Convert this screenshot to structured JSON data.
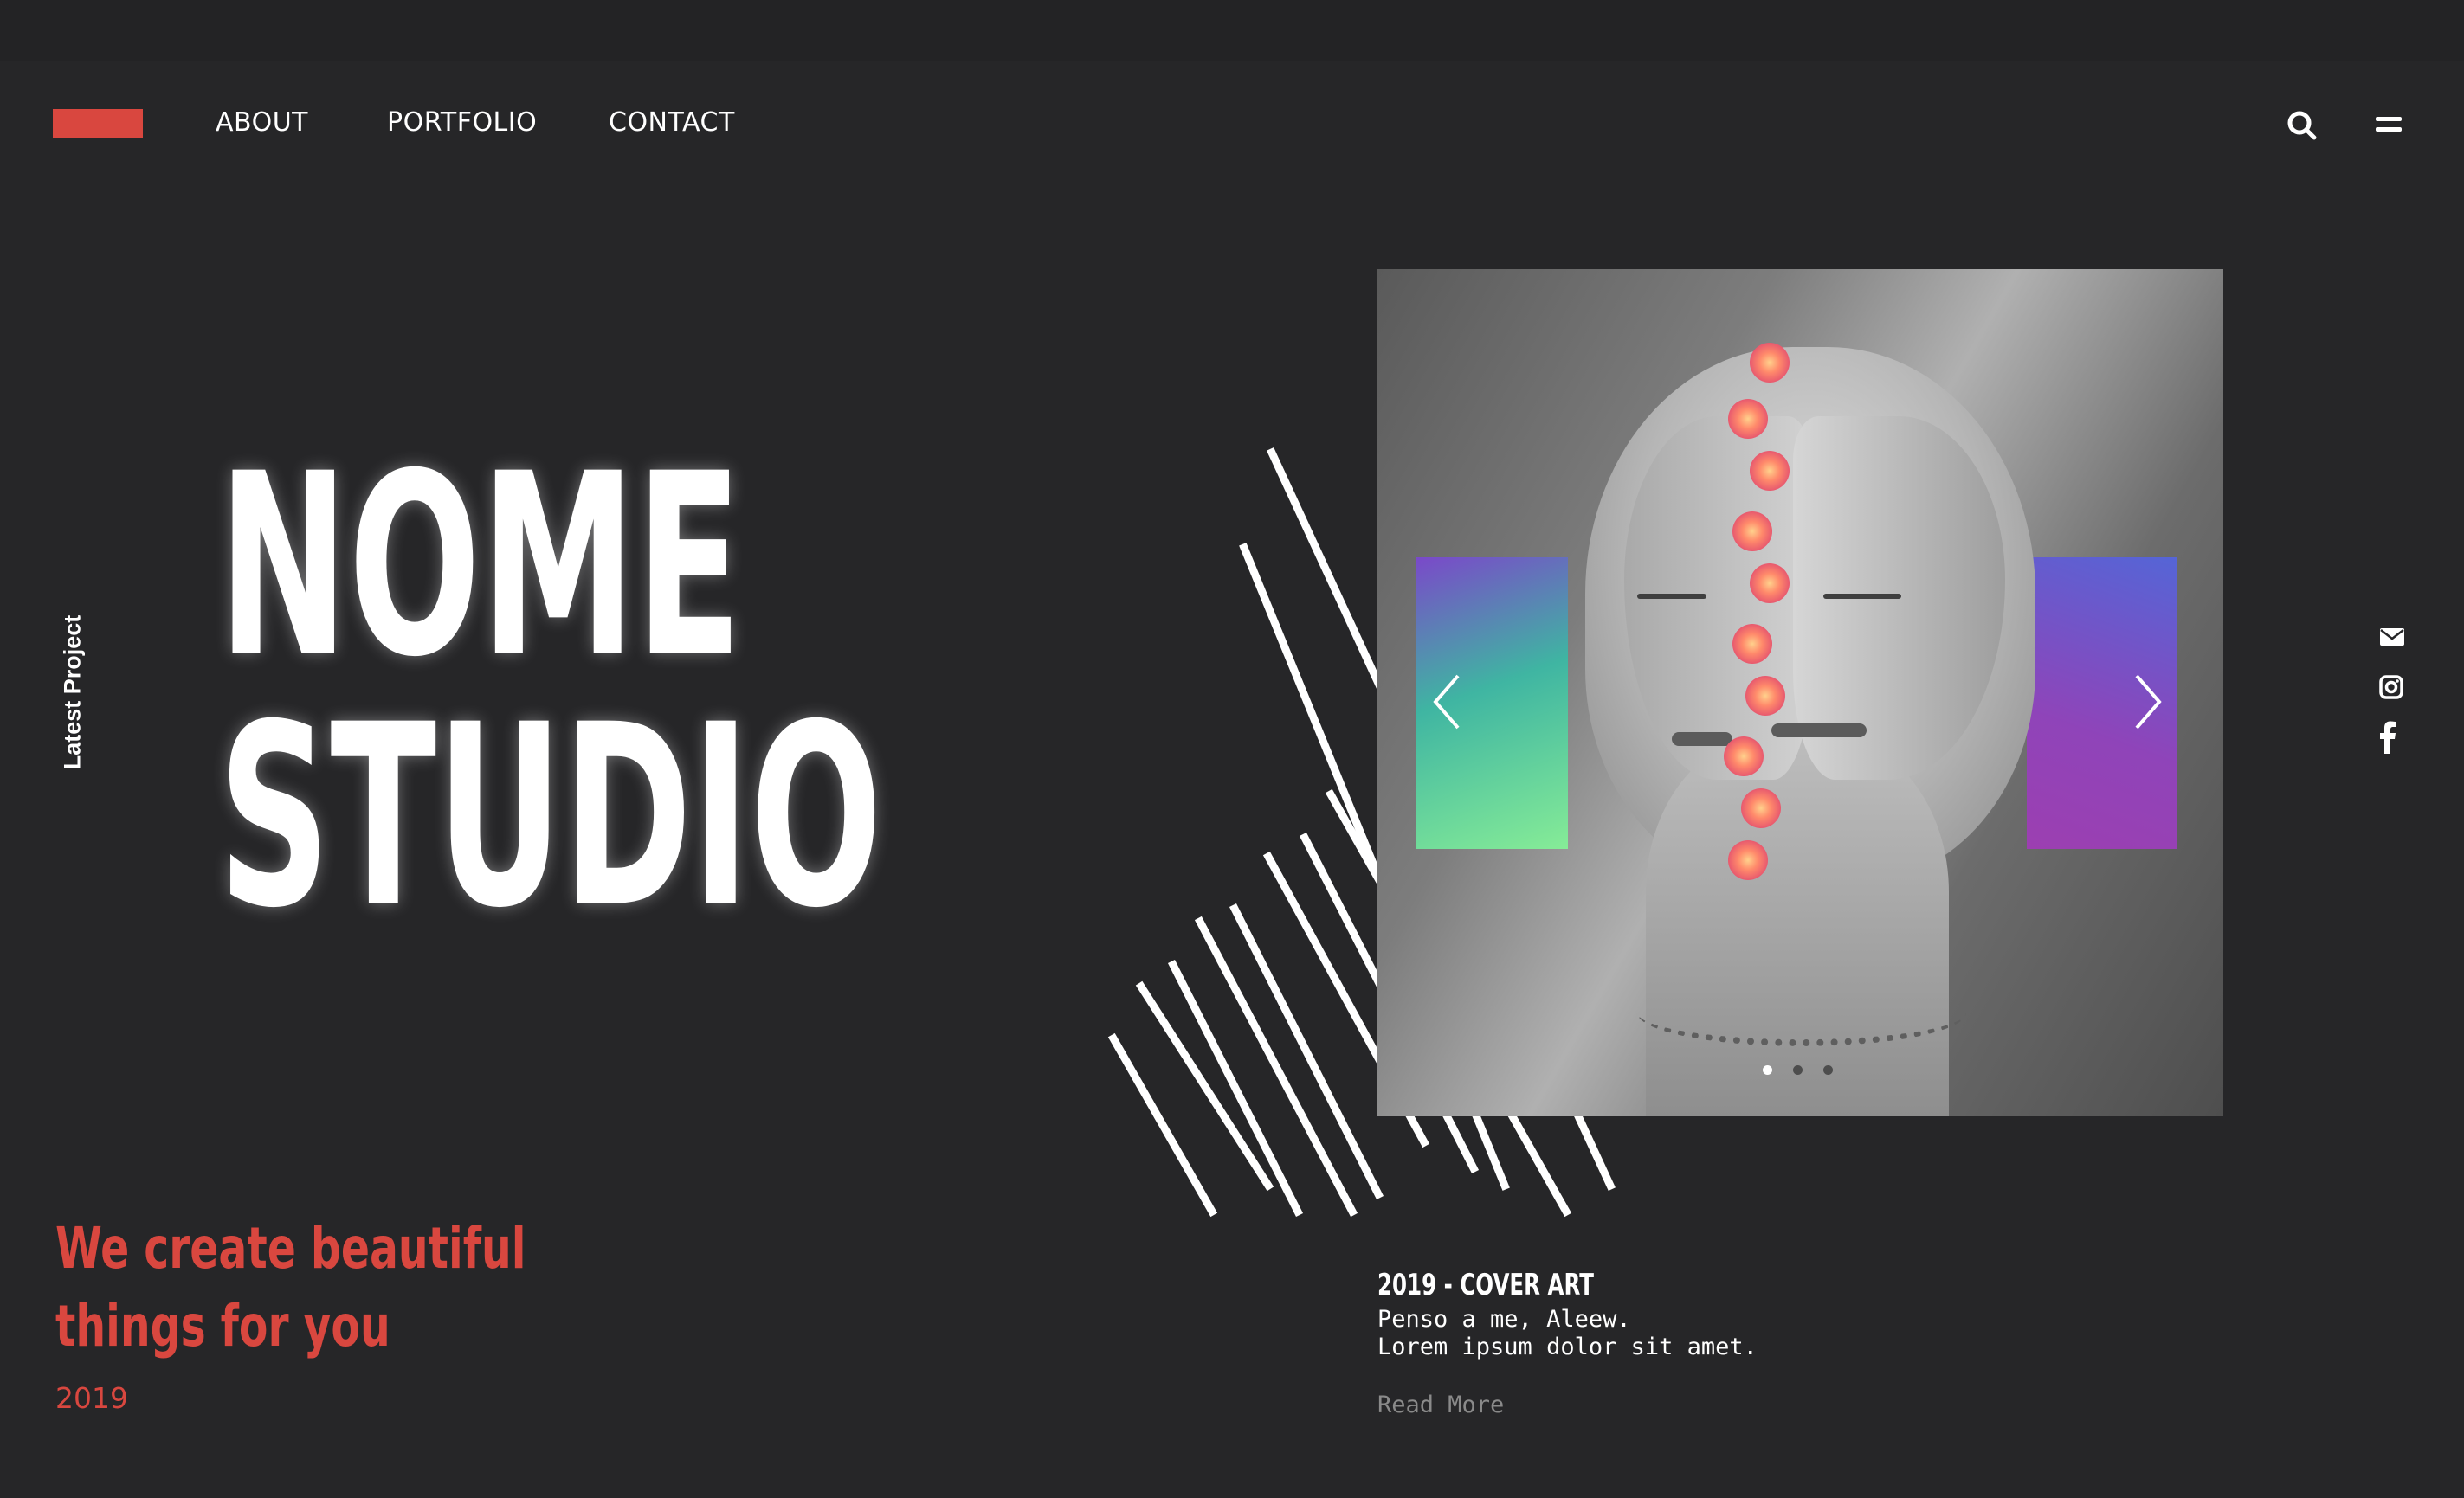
{
  "colors": {
    "background": "#262628",
    "accent": "#d9473f",
    "text": "#ffffff",
    "muted": "#8a8a8a"
  },
  "nav": {
    "logo": "red-bar-logo",
    "items": [
      {
        "label": "ABOUT"
      },
      {
        "label": "PORTFOLIO"
      },
      {
        "label": "CONTACT"
      }
    ],
    "icons": [
      "search-icon",
      "menu-icon"
    ]
  },
  "side_label": "Latest Project",
  "hero": {
    "line1": "NOME",
    "line2": "STUDIO"
  },
  "tagline": {
    "line1": "We create beautiful",
    "line2": "things for you",
    "year": "2019"
  },
  "slider": {
    "current_slide": 1,
    "total_slides": 3,
    "prev_icon": "chevron-left-icon",
    "next_icon": "chevron-right-icon"
  },
  "social": [
    "mail-icon",
    "instagram-icon",
    "facebook-icon"
  ],
  "project": {
    "title": "2019 - COVER ART",
    "line1": "Penso a me, Aleew.",
    "line2": "Lorem ipsum dolor sit amet.",
    "read_more": "Read More"
  }
}
